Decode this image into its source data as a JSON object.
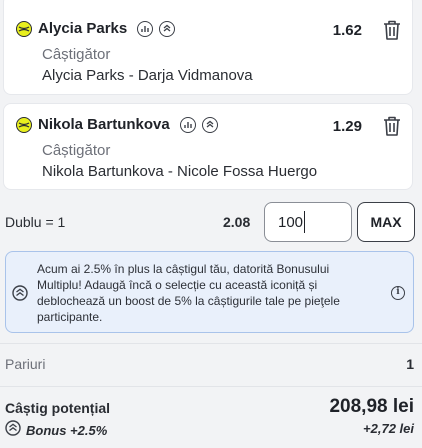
{
  "selections": [
    {
      "player": "Alycia Parks",
      "odd": "1.62",
      "market": "Câștigător",
      "event": "Alycia Parks - Darja Vidmanova"
    },
    {
      "player": "Nikola Bartunkova",
      "odd": "1.29",
      "market": "Câștigător",
      "event": "Nikola Bartunkova - Nicole Fossa Huergo"
    }
  ],
  "bet": {
    "type_label": "Dublu = 1",
    "total_odd": "2.08",
    "stake_value": "100",
    "max_label": "MAX"
  },
  "bonus_notice": {
    "text": "Acum ai 2.5% în plus la câștigul tău, datorită Bonusului Multiplu! Adaugă încă o selecție cu această iconiță și deblochează un boost de 5% la câștigurile tale pe pieţele participante."
  },
  "summary": {
    "pariuri_label": "Pariuri",
    "pariuri_value": "1",
    "castig_label": "Câștig potențial",
    "castig_value": "208,98 lei",
    "bonus_label": "Bonus +2.5%",
    "bonus_value": "+2,72 lei"
  },
  "icons": {
    "sport": "tennis-ball-icon",
    "stats": "stats-icon",
    "boost": "bonus-multiplier-icon",
    "delete": "trash-icon",
    "info": "info-icon"
  },
  "colors": {
    "ball": "#e8ef1e",
    "notice_bg": "#e9f0fb",
    "notice_border": "#a9c3ea"
  }
}
